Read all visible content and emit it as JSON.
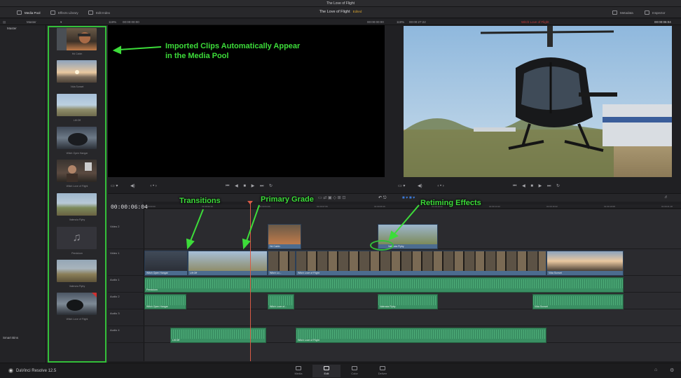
{
  "window": {
    "title": "The Love of Flight"
  },
  "toolbar": {
    "media_pool": "Media Pool",
    "effects_library": "Effects Library",
    "edit_index": "Edit Index",
    "project_title": "The Love of Flight",
    "edited_badge": "Edited",
    "metadata": "Metadata",
    "inspector": "Inspector"
  },
  "subbar": {
    "bin_name": "Master",
    "src_zoom": "119%",
    "src_timecode_left": "00:00:00:00",
    "src_timecode_right": "00:00:00:00",
    "prog_zoom": "119%",
    "prog_duration": "00:00:27:22",
    "timeline_name": "Witch Love of Flight",
    "prog_timecode": "00:00:06:04"
  },
  "bins": {
    "master": "Master",
    "smart_bins": "Smart Bins"
  },
  "media_pool": {
    "clips": [
      {
        "label": "Hd Cabin",
        "thumb": "cabin"
      },
      {
        "label": "Vida Sunset",
        "thumb": "sunset"
      },
      {
        "label": "Lift Off",
        "thumb": "liftoff"
      },
      {
        "label": "Witch Open Hangar",
        "thumb": "hangar"
      },
      {
        "label": "Witch Love of Flight",
        "thumb": "face"
      },
      {
        "label": "Valencia Flyby",
        "thumb": "flyby"
      },
      {
        "label": "Pendulum",
        "thumb": "audio"
      },
      {
        "label": "Valencia Flyby",
        "thumb": "flyby2"
      },
      {
        "label": "Witch Love of Flight",
        "thumb": "face2"
      }
    ]
  },
  "timeline": {
    "timecode": "00:00:06:04",
    "ruler": [
      "01:00:00:00",
      "01:00:02:10",
      "01:00:04:20",
      "01:00:07:06",
      "01:00:09:16",
      "01:00:12:02",
      "01:00:14:12",
      "01:00:16:22",
      "01:00:19:08",
      "01:00:21:18"
    ],
    "tracks": {
      "v2": "Video 2",
      "v1": "Video 1",
      "a1": "Audio 1",
      "a2": "Audio 2",
      "a3": "Audio 3",
      "a4": "Audio 4"
    },
    "v1_clips": [
      "Witch Open Hangar",
      "Lift Off",
      "Witch Lo...",
      "Witch Love of Flight",
      "Vida Sunset"
    ],
    "v2_clips": [
      "Hd Cabin",
      "Valencia Flyby"
    ],
    "a1_clips": [
      "Pendulum"
    ],
    "a2_clips": [
      "Witch Open Hangar",
      "Witch Love of...",
      "Valencia Flyby",
      "Vida Sunset"
    ],
    "a4_clips": [
      "Lift Off",
      "Witch Love of Flight"
    ]
  },
  "annotations": {
    "pool_line1": "Imported Clips Automatically Appear",
    "pool_line2": "in the Media Pool",
    "transitions": "Transitions",
    "primary_grade": "Primary Grade",
    "retiming": "Retiming Effects"
  },
  "bottom": {
    "brand": "DaVinci Resolve 12.5",
    "tabs": [
      "Media",
      "Edit",
      "Color",
      "Deliver"
    ]
  },
  "colors": {
    "annotation_green": "#3ddc3a",
    "video_clip": "#4c6c8f",
    "audio_clip": "#3a8f63",
    "playhead": "#d85a45"
  }
}
